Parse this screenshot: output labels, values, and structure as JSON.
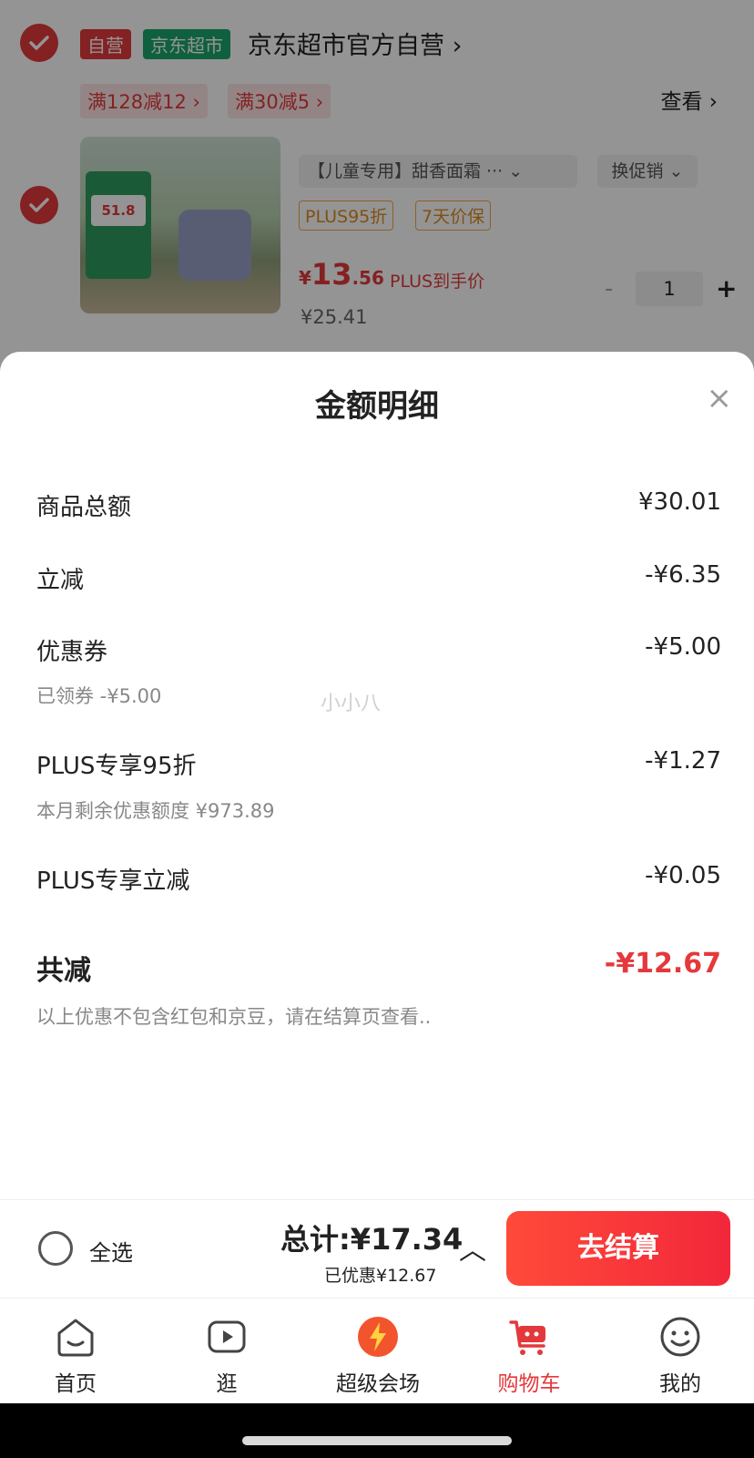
{
  "cart": {
    "shop": {
      "tag_self": "自营",
      "tag_market": "京东超市",
      "name": "京东超市官方自营 ›"
    },
    "promos": [
      "满128减12 ›",
      "满30减5 ›"
    ],
    "view_link": "查看 ›",
    "product": {
      "image_badge_price": "51.8",
      "variant": "【儿童专用】甜香面霜 ··· ⌄",
      "swap_promo": "换促销 ⌄",
      "tags": [
        "PLUS95折",
        "7天价保"
      ],
      "price_symbol": "¥",
      "price_int": "13",
      "price_dec": ".56",
      "price_note": "PLUS到手价",
      "original_price": "¥25.41",
      "qty_minus": "-",
      "quantity": "1",
      "qty_plus": "+"
    }
  },
  "sheet": {
    "title": "金额明细",
    "close": "×",
    "rows": [
      {
        "label": "商品总额",
        "value": "¥30.01"
      },
      {
        "label": "立减",
        "value": "-¥6.35"
      },
      {
        "label": "优惠券",
        "value": "-¥5.00",
        "sub": "已领券 -¥5.00"
      },
      {
        "label": "PLUS专享95折",
        "value": "-¥1.27",
        "sub": "本月剩余优惠额度 ¥973.89"
      },
      {
        "label": "PLUS专享立减",
        "value": "-¥0.05"
      }
    ],
    "total_label": "共减",
    "total_value": "-¥12.67",
    "note": "以上优惠不包含红包和京豆，请在结算页查看..",
    "watermark": "小小八"
  },
  "checkout": {
    "select_all": "全选",
    "total": "总计:¥17.34",
    "saved": "已优惠¥12.67",
    "caret": "︿",
    "pay_button": "去结算"
  },
  "nav": {
    "items": [
      {
        "label": "首页",
        "icon": "home-icon"
      },
      {
        "label": "逛",
        "icon": "video-play-icon"
      },
      {
        "label": "超级会场",
        "icon": "super-venue-icon"
      },
      {
        "label": "购物车",
        "icon": "cart-icon",
        "active": true
      },
      {
        "label": "我的",
        "icon": "profile-icon"
      }
    ]
  },
  "colors": {
    "accent": "#e4393c",
    "market_green": "#1aa56b",
    "tag_orange": "#e08a1f"
  }
}
